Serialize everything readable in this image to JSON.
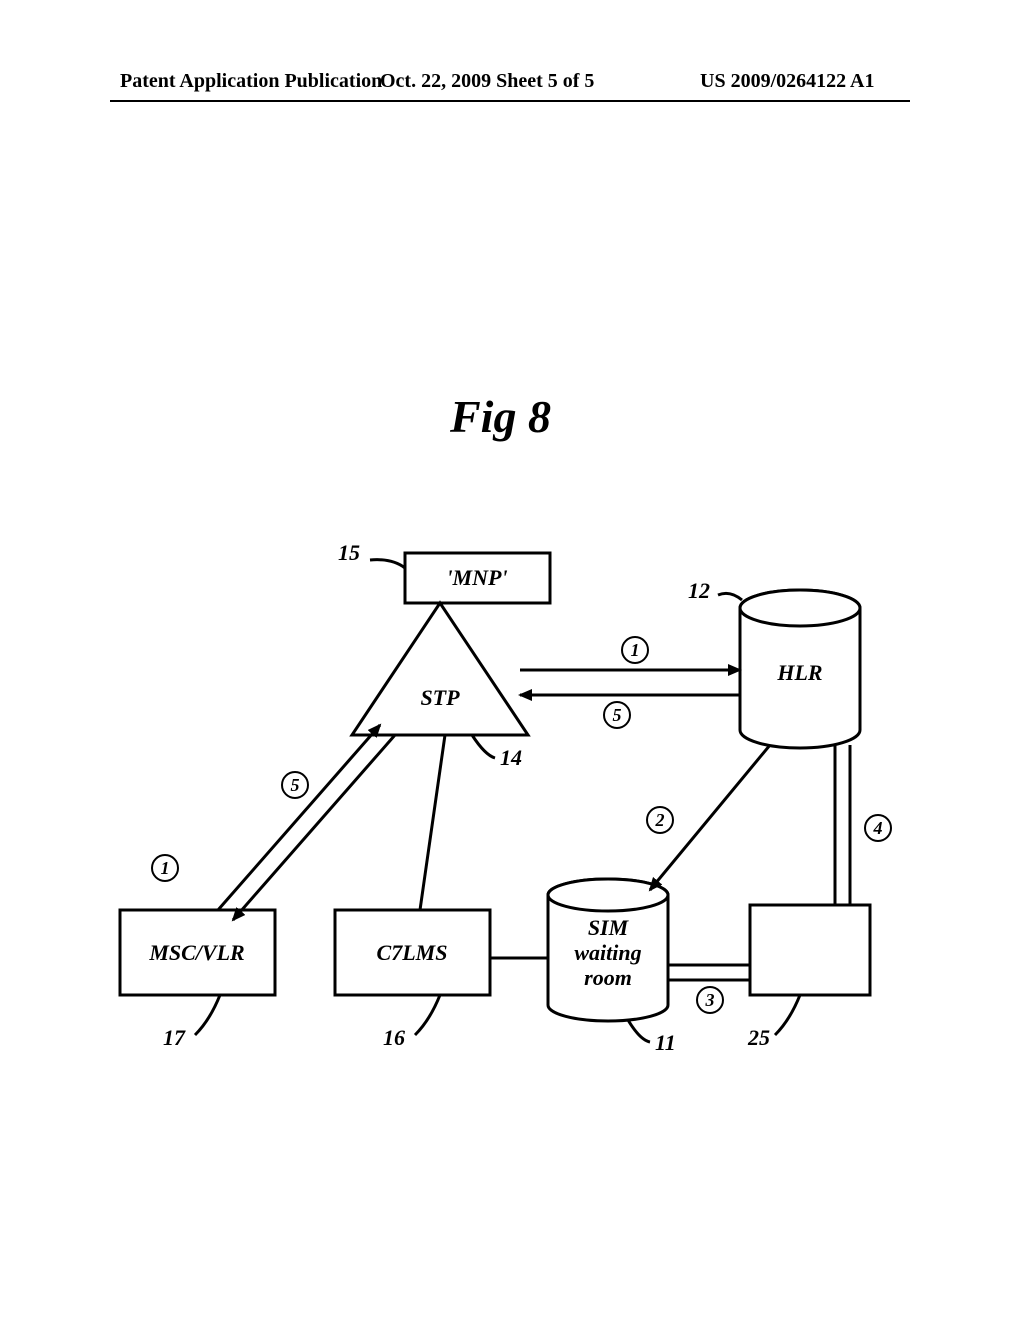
{
  "header": {
    "left": "Patent Application Publication",
    "mid": "Oct. 22, 2009  Sheet 5 of 5",
    "right": "US 2009/0264122 A1"
  },
  "figure": {
    "title": "Fig 8"
  },
  "nodes": {
    "mnp": {
      "label": "'MNP'",
      "ref": "15"
    },
    "stp": {
      "label": "STP",
      "ref": "14"
    },
    "hlr": {
      "label": "HLR",
      "ref": "12"
    },
    "msc": {
      "label": "MSC/VLR",
      "ref": "17"
    },
    "c7lms": {
      "label": "C7LMS",
      "ref": "16"
    },
    "sim": {
      "label_l1": "SIM",
      "label_l2": "waiting",
      "label_l3": "room",
      "ref": "11"
    },
    "box25": {
      "ref": "25"
    }
  },
  "steps": {
    "s1a": "1",
    "s1b": "1",
    "s2": "2",
    "s3": "3",
    "s4": "4",
    "s5a": "5",
    "s5b": "5"
  },
  "chart_data": {
    "type": "diagram",
    "title": "Fig 8",
    "nodes": [
      {
        "id": "MNP",
        "label": "'MNP'",
        "ref": 15,
        "shape": "rect"
      },
      {
        "id": "STP",
        "label": "STP",
        "ref": 14,
        "shape": "triangle"
      },
      {
        "id": "HLR",
        "label": "HLR",
        "ref": 12,
        "shape": "cylinder"
      },
      {
        "id": "MSC_VLR",
        "label": "MSC/VLR",
        "ref": 17,
        "shape": "rect"
      },
      {
        "id": "C7LMS",
        "label": "C7LMS",
        "ref": 16,
        "shape": "rect"
      },
      {
        "id": "SIM_WR",
        "label": "SIM waiting room",
        "ref": 11,
        "shape": "cylinder"
      },
      {
        "id": "BOX25",
        "label": "",
        "ref": 25,
        "shape": "rect"
      }
    ],
    "edges": [
      {
        "from": "MNP",
        "to": "STP",
        "step": null,
        "directed": false,
        "note": "attached"
      },
      {
        "from": "MSC_VLR",
        "to": "STP",
        "step": 1,
        "directed": true
      },
      {
        "from": "STP",
        "to": "HLR",
        "step": 1,
        "directed": true
      },
      {
        "from": "HLR",
        "to": "SIM_WR",
        "step": 2,
        "directed": true
      },
      {
        "from": "SIM_WR",
        "to": "BOX25",
        "step": 3,
        "directed": true
      },
      {
        "from": "BOX25",
        "to": "SIM_WR",
        "step": 3,
        "directed": true
      },
      {
        "from": "BOX25",
        "to": "HLR",
        "step": 4,
        "directed": true
      },
      {
        "from": "HLR",
        "to": "BOX25",
        "step": 4,
        "directed": true
      },
      {
        "from": "HLR",
        "to": "STP",
        "step": 5,
        "directed": true
      },
      {
        "from": "STP",
        "to": "MSC_VLR",
        "step": 5,
        "directed": true
      },
      {
        "from": "STP",
        "to": "C7LMS",
        "step": null,
        "directed": false
      },
      {
        "from": "C7LMS",
        "to": "SIM_WR",
        "step": null,
        "directed": false
      }
    ]
  }
}
